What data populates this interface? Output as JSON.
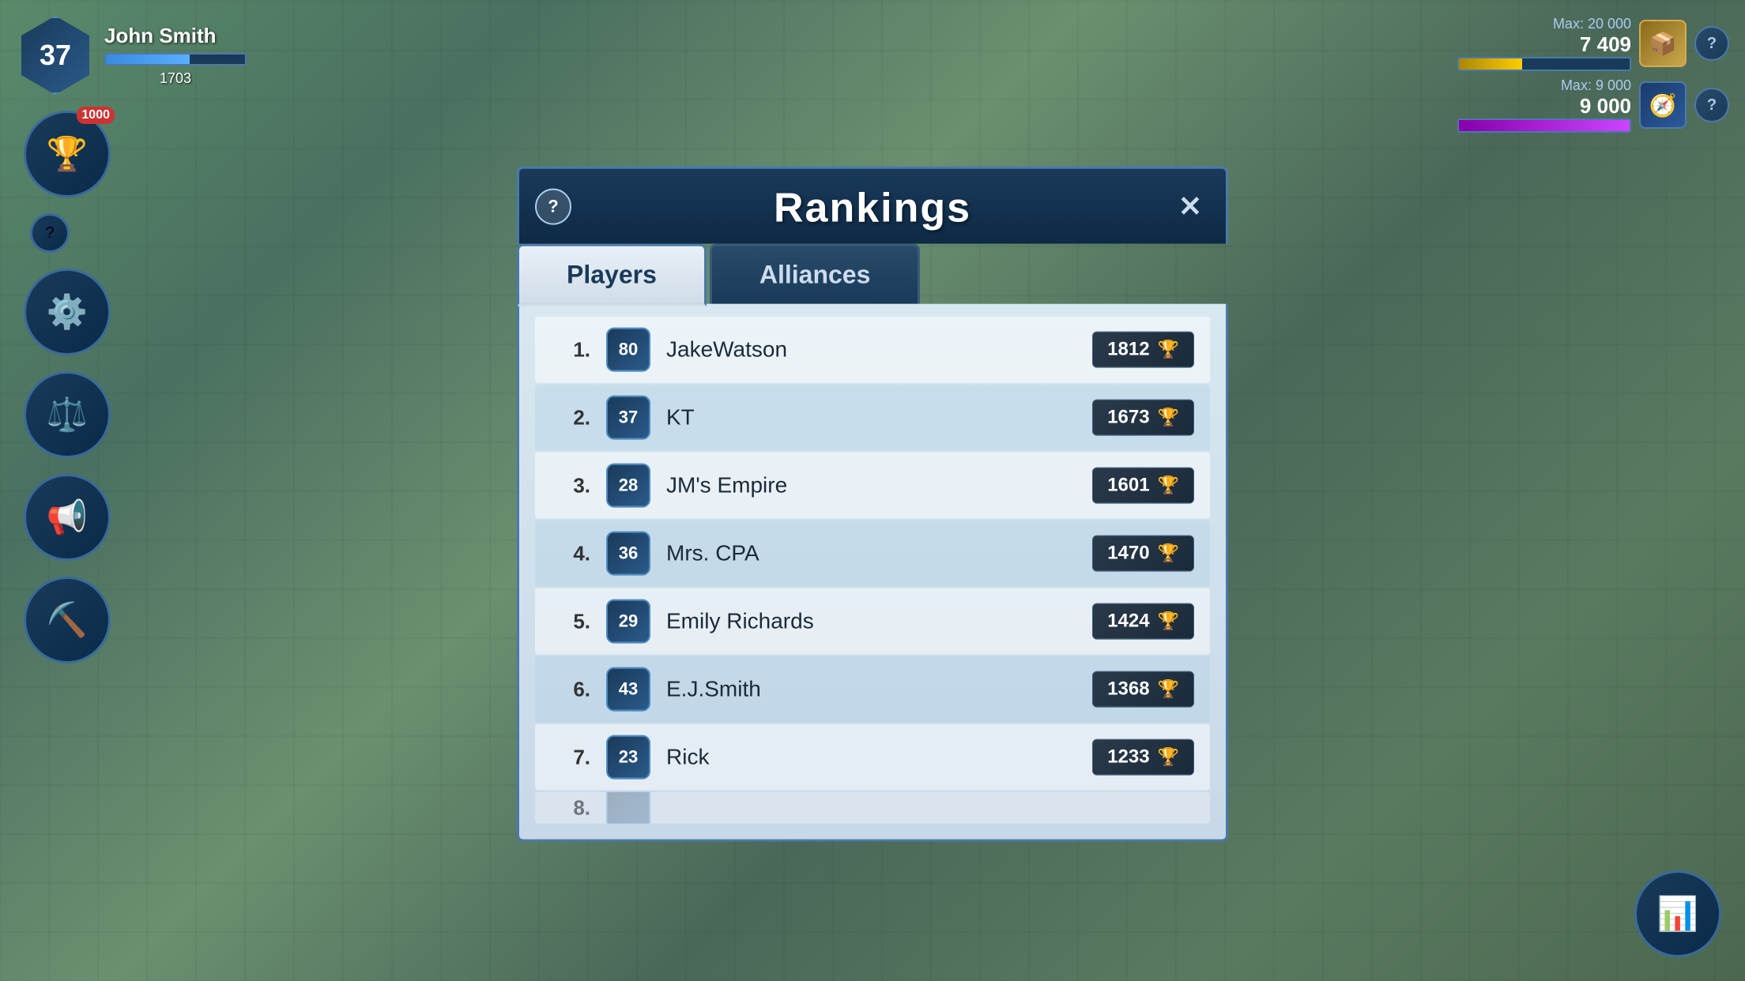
{
  "background": {
    "color": "#4a7a5a"
  },
  "hud": {
    "player": {
      "name": "John Smith",
      "level": "37",
      "xp": "1703",
      "xp_pct": 60
    },
    "resources": {
      "gold_max": "Max: 20 000",
      "gold_current": "7 409",
      "gold_pct": 37,
      "second_max": "Max: 9 000",
      "second_current": "9 000",
      "second_pct": 100
    },
    "sidebar": {
      "trophy_badge": "1000",
      "icons": [
        "trophy",
        "gear",
        "scales",
        "megaphone",
        "tools"
      ]
    }
  },
  "modal": {
    "title": "Rankings",
    "help_label": "?",
    "close_label": "✕",
    "tabs": [
      {
        "label": "Players",
        "active": true
      },
      {
        "label": "Alliances",
        "active": false
      }
    ],
    "rankings": [
      {
        "rank": "1.",
        "level": "80",
        "name": "JakeWatson",
        "score": "1812"
      },
      {
        "rank": "2.",
        "level": "37",
        "name": "KT",
        "score": "1673"
      },
      {
        "rank": "3.",
        "level": "28",
        "name": "JM's Empire",
        "score": "1601"
      },
      {
        "rank": "4.",
        "level": "36",
        "name": "Mrs. CPA",
        "score": "1470"
      },
      {
        "rank": "5.",
        "level": "29",
        "name": "Emily Richards",
        "score": "1424"
      },
      {
        "rank": "6.",
        "level": "43",
        "name": "E.J.Smith",
        "score": "1368"
      },
      {
        "rank": "7.",
        "level": "23",
        "name": "Rick",
        "score": "1233"
      }
    ],
    "partial_rank": "8."
  }
}
